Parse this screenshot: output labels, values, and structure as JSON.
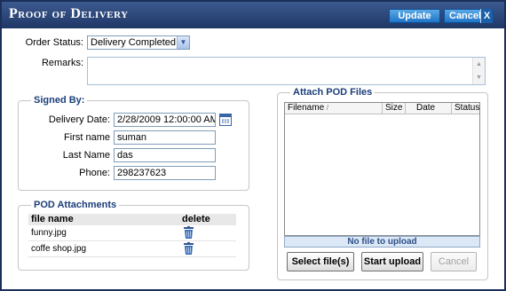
{
  "window": {
    "title": "Proof of Delivery",
    "update_label": "Update",
    "cancel_label": "Cancel",
    "close_glyph": "X"
  },
  "order_status": {
    "label": "Order Status:",
    "selected": "Delivery Completed"
  },
  "remarks": {
    "label": "Remarks:",
    "value": ""
  },
  "signed_by": {
    "legend": "Signed By:",
    "fields": [
      {
        "label": "Delivery Date:",
        "value": "2/28/2009 12:00:00 AM"
      },
      {
        "label": "First name",
        "value": "suman"
      },
      {
        "label": "Last Name",
        "value": "das"
      },
      {
        "label": "Phone:",
        "value": "298237623"
      }
    ]
  },
  "pod_attachments": {
    "legend": "POD Attachments",
    "columns": {
      "file_name": "file name",
      "delete": "delete"
    },
    "rows": [
      {
        "file_name": "funny.jpg"
      },
      {
        "file_name": "coffe shop.jpg"
      }
    ]
  },
  "attach_pod_files": {
    "legend": "Attach POD Files",
    "columns": [
      "Filename",
      "Size",
      "Date",
      "Status"
    ],
    "sort_glyph": "/",
    "status_text": "No file to upload",
    "select_label": "Select file(s)",
    "start_label": "Start upload",
    "cancel_label": "Cancel"
  },
  "icons": {
    "calendar": "calendar-icon",
    "trash": "trash-icon",
    "dropdown": "chevron-down-icon"
  },
  "colors": {
    "titlebar": "#2a4577",
    "button_blue": "#1f74c7",
    "legend_text": "#1a3e7a",
    "status_bar": "#dce8f6"
  }
}
